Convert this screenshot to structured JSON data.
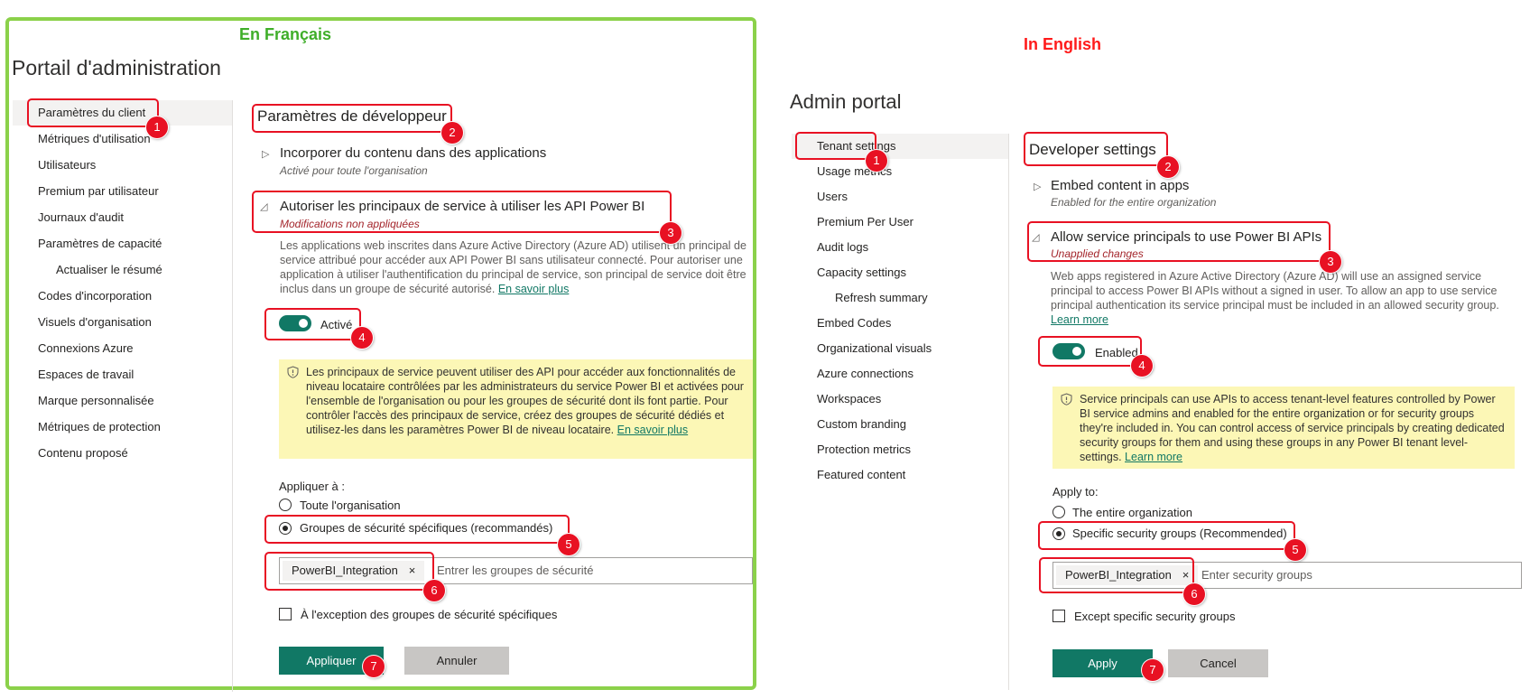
{
  "fr": {
    "caption": "En Français",
    "portal_title": "Portail d'administration",
    "nav": [
      {
        "label": "Paramètres du client",
        "active": true
      },
      {
        "label": "Métriques d'utilisation"
      },
      {
        "label": "Utilisateurs"
      },
      {
        "label": "Premium par utilisateur"
      },
      {
        "label": "Journaux d'audit"
      },
      {
        "label": "Paramètres de capacité"
      },
      {
        "label": "Actualiser le résumé",
        "sub": true
      },
      {
        "label": "Codes d'incorporation"
      },
      {
        "label": "Visuels d'organisation"
      },
      {
        "label": "Connexions Azure"
      },
      {
        "label": "Espaces de travail"
      },
      {
        "label": "Marque personnalisée"
      },
      {
        "label": "Métriques de protection"
      },
      {
        "label": "Contenu proposé"
      }
    ],
    "section_title": "Paramètres de développeur",
    "embed": {
      "title": "Incorporer du contenu dans des applications",
      "subtitle": "Activé pour toute l'organisation"
    },
    "allow": {
      "title": "Autoriser les principaux de service à utiliser les API Power BI",
      "subtitle": "Modifications non appliquées"
    },
    "description": "Les applications web inscrites dans Azure Active Directory (Azure AD) utilisent un principal de service attribué pour accéder aux API Power BI sans utilisateur connecté. Pour autoriser une application à utiliser l'authentification du principal de service, son principal de service doit être inclus dans un groupe de sécurité autorisé.",
    "learn_more": "En savoir plus",
    "toggle_label": "Activé",
    "warning": "Les principaux de service peuvent utiliser des API pour accéder aux fonctionnalités de niveau locataire contrôlées par les administrateurs du service Power BI et activées pour l'ensemble de l'organisation ou pour les groupes de sécurité dont ils font partie. Pour contrôler l'accès des principaux de service, créez des groupes de sécurité dédiés et utilisez-les dans les paramètres Power BI de niveau locataire.",
    "apply_to": "Appliquer à :",
    "radio_all": "Toute l'organisation",
    "radio_specific": "Groupes de sécurité spécifiques (recommandés)",
    "chip": "PowerBI_Integration",
    "chip_remove": "×",
    "placeholder": "Entrer les groupes de sécurité",
    "except": "À l'exception des groupes de sécurité spécifiques",
    "apply_button": "Appliquer",
    "cancel_button": "Annuler"
  },
  "en": {
    "caption": "In English",
    "portal_title": "Admin portal",
    "nav": [
      {
        "label": "Tenant settings",
        "active": true
      },
      {
        "label": "Usage metrics"
      },
      {
        "label": "Users"
      },
      {
        "label": "Premium Per User"
      },
      {
        "label": "Audit logs"
      },
      {
        "label": "Capacity settings"
      },
      {
        "label": "Refresh summary",
        "sub": true
      },
      {
        "label": "Embed Codes"
      },
      {
        "label": "Organizational visuals"
      },
      {
        "label": "Azure connections"
      },
      {
        "label": "Workspaces"
      },
      {
        "label": "Custom branding"
      },
      {
        "label": "Protection metrics"
      },
      {
        "label": "Featured content"
      }
    ],
    "section_title": "Developer settings",
    "embed": {
      "title": "Embed content in apps",
      "subtitle": "Enabled for the entire organization"
    },
    "allow": {
      "title": "Allow service principals to use Power BI APIs",
      "subtitle": "Unapplied changes"
    },
    "description": "Web apps registered in Azure Active Directory (Azure AD) will use an assigned service principal to access Power BI APIs without a signed in user. To allow an app to use service principal authentication its service principal must be included in an allowed security group.",
    "learn_more": "Learn more",
    "toggle_label": "Enabled",
    "warning": "Service principals can use APIs to access tenant-level features controlled by Power BI service admins and enabled for the entire organization or for security groups they're included in. You can control access of service principals by creating dedicated security groups for them and using these groups in any Power BI tenant level-settings.",
    "apply_to": "Apply to:",
    "radio_all": "The entire organization",
    "radio_specific": "Specific security groups (Recommended)",
    "chip": "PowerBI_Integration",
    "chip_remove": "×",
    "placeholder": "Enter security groups",
    "except": "Except specific security groups",
    "apply_button": "Apply",
    "cancel_button": "Cancel"
  },
  "badges": [
    "1",
    "2",
    "3",
    "4",
    "5",
    "6",
    "7"
  ],
  "colors": {
    "accent": "#117865",
    "annotation": "#e81123",
    "frame": "#8bd14a",
    "warning_bg": "#fcf7b6"
  }
}
